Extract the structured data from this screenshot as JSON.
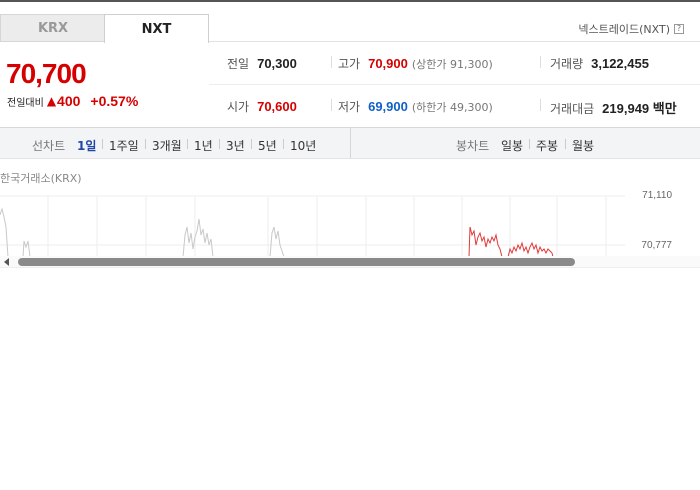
{
  "tabs": [
    {
      "label": "KRX",
      "active": false
    },
    {
      "label": "NXT",
      "active": true
    }
  ],
  "nxt_link": {
    "label": "넥스트레이드(NXT)",
    "help": "?"
  },
  "quote": {
    "price": "70,700",
    "change_label": "전일대비",
    "change_value": "400",
    "change_direction": "up",
    "change_percent": "+0.57%"
  },
  "stats": {
    "prev_close": {
      "label": "전일",
      "value": "70,300"
    },
    "high": {
      "label": "고가",
      "value": "70,900",
      "sub": "(상한가 91,300)"
    },
    "volume": {
      "label": "거래량",
      "value": "3,122,455"
    },
    "open": {
      "label": "시가",
      "value": "70,600"
    },
    "low": {
      "label": "저가",
      "value": "69,900",
      "sub": "(하한가 49,300)"
    },
    "amount": {
      "label": "거래대금",
      "value": "219,949 백만"
    }
  },
  "periods": {
    "label": "선차트",
    "items": [
      "1일",
      "1주일",
      "3개월",
      "1년",
      "3년",
      "5년",
      "10년"
    ],
    "active": "1일"
  },
  "candles": {
    "label": "봉차트",
    "items": [
      "일봉",
      "주봉",
      "월봉"
    ]
  },
  "chart": {
    "market_label": "한국거래소(KRX)",
    "y_ticks": [
      "71,110",
      "70,777"
    ]
  },
  "colors": {
    "up": "#d60000",
    "down": "#1060c8",
    "active_period": "#2146a8"
  }
}
